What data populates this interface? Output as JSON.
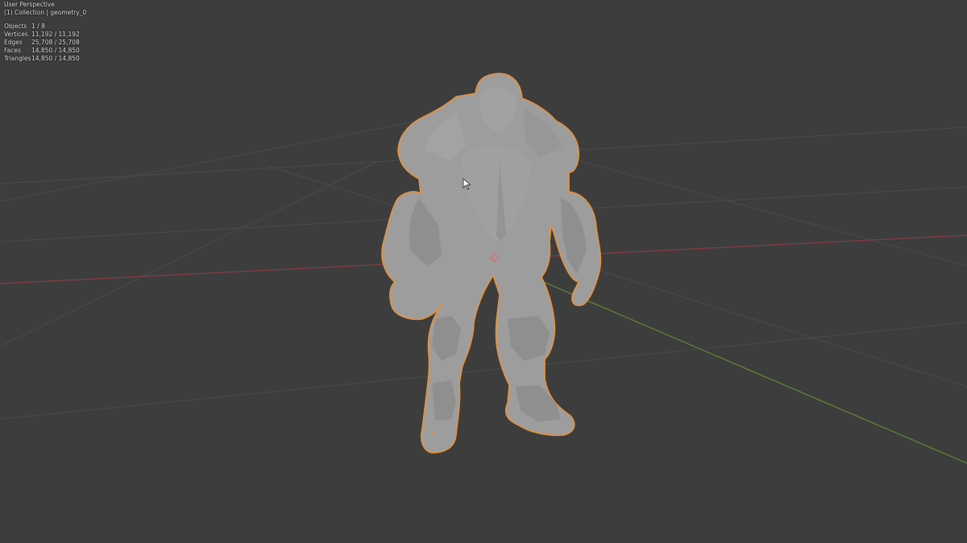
{
  "viewport": {
    "view_name": "User Perspective",
    "collection": "(1) Collection | geometry_0",
    "stats": [
      {
        "label": "Objects",
        "value": "1 / 8"
      },
      {
        "label": "Vertices",
        "value": "11,192 / 11,192"
      },
      {
        "label": "Edges",
        "value": "25,708 / 25,708"
      },
      {
        "label": "Faces",
        "value": "14,850 / 14,850"
      },
      {
        "label": "Triangles",
        "value": "14,850 / 14,850"
      }
    ]
  },
  "colors": {
    "background": "#3d3d3d",
    "grid": "#4a4a4a",
    "x_axis": "#8a3b45",
    "y_axis": "#5f8a36",
    "mesh": "#9a9a9a",
    "selection_outline": "#e8923a"
  },
  "icons": {
    "cursor": "mouse-pointer-icon",
    "origin": "object-origin-icon"
  }
}
